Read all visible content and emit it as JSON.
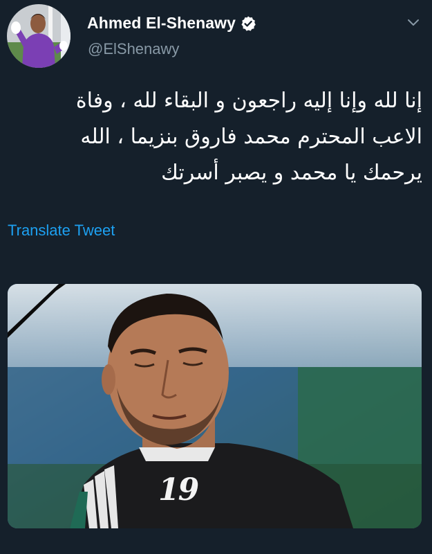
{
  "author": {
    "display_name": "Ahmed El-Shenawy",
    "handle": "@ElShenawy",
    "verified": true,
    "avatar_icon": "goalkeeper-avatar"
  },
  "tweet": {
    "text_lines": [
      "إنا لله وإنا إليه راجعون و البقاء لله ، وفاة",
      "الاعب المحترم محمد فاروق بنزيما ، الله",
      "يرحمك يا محمد و يصبر أسرتك"
    ],
    "translate_label": "Translate Tweet",
    "media": {
      "description_icon": "mourning-photo",
      "jersey_number": "19"
    }
  },
  "colors": {
    "background": "#15202b",
    "link": "#1da1f2",
    "secondary_text": "#8899a6",
    "verified_badge": "#ffffff"
  },
  "icons": {
    "verified": "verified-badge-icon",
    "menu": "chevron-down-icon"
  }
}
